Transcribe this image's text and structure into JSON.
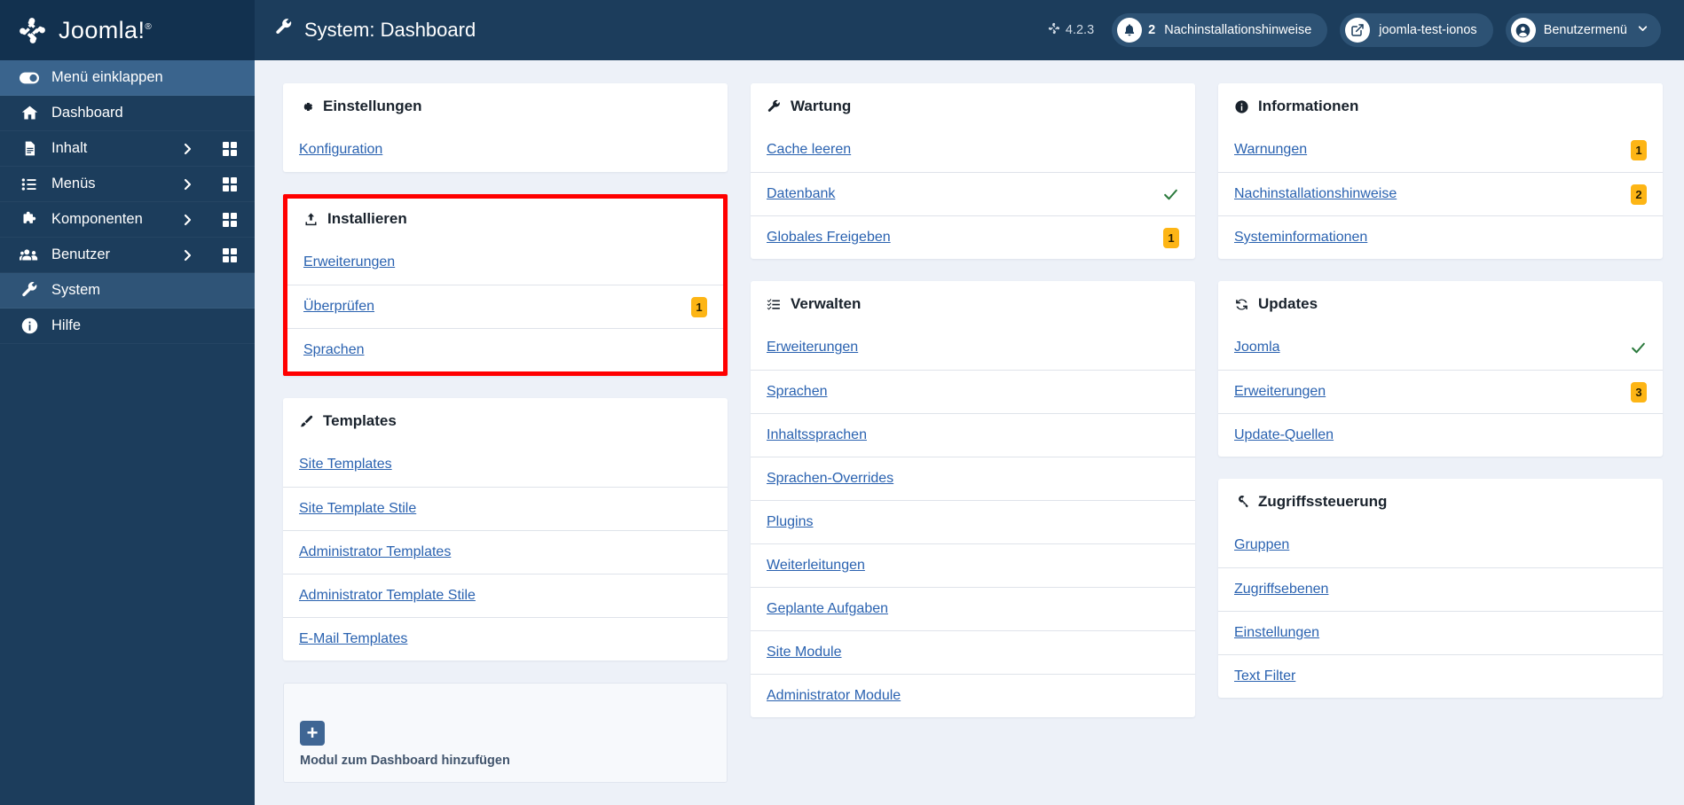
{
  "brand": {
    "name": "Joomla!",
    "trademark": "®"
  },
  "sidebar": {
    "collapse_label": "Menü einklappen",
    "items": [
      {
        "label": "Dashboard",
        "icon": "home-icon",
        "arrow": false,
        "grid": false,
        "active": false
      },
      {
        "label": "Inhalt",
        "icon": "document-icon",
        "arrow": true,
        "grid": true,
        "active": false
      },
      {
        "label": "Menüs",
        "icon": "list-icon",
        "arrow": true,
        "grid": true,
        "active": false
      },
      {
        "label": "Komponenten",
        "icon": "puzzle-icon",
        "arrow": true,
        "grid": true,
        "active": false
      },
      {
        "label": "Benutzer",
        "icon": "users-icon",
        "arrow": true,
        "grid": true,
        "active": false
      },
      {
        "label": "System",
        "icon": "wrench-icon",
        "arrow": false,
        "grid": false,
        "active": true
      },
      {
        "label": "Hilfe",
        "icon": "info-icon",
        "arrow": false,
        "grid": false,
        "active": false
      }
    ]
  },
  "header": {
    "title": "System: Dashboard",
    "version": "4.2.3",
    "notifications": {
      "count": "2",
      "label": "Nachinstallationshinweise"
    },
    "site": {
      "label": "joomla-test-ionos"
    },
    "user": {
      "label": "Benutzermenü"
    }
  },
  "panels": {
    "einstellungen": {
      "title": "Einstellungen",
      "icon": "gear-icon",
      "rows": [
        {
          "label": "Konfiguration",
          "badge": "",
          "check": false
        }
      ]
    },
    "installieren": {
      "title": "Installieren",
      "icon": "upload-icon",
      "highlighted": true,
      "rows": [
        {
          "label": "Erweiterungen",
          "badge": "",
          "check": false
        },
        {
          "label": "Überprüfen",
          "badge": "1",
          "check": false
        },
        {
          "label": "Sprachen",
          "badge": "",
          "check": false
        }
      ]
    },
    "templates": {
      "title": "Templates",
      "icon": "brush-icon",
      "rows": [
        {
          "label": "Site Templates",
          "badge": "",
          "check": false
        },
        {
          "label": "Site Template Stile",
          "badge": "",
          "check": false
        },
        {
          "label": "Administrator Templates",
          "badge": "",
          "check": false
        },
        {
          "label": "Administrator Template Stile",
          "badge": "",
          "check": false
        },
        {
          "label": "E-Mail Templates",
          "badge": "",
          "check": false
        }
      ]
    },
    "add_module": {
      "label": "Modul zum Dashboard hinzufügen",
      "icon": "plus-icon"
    },
    "wartung": {
      "title": "Wartung",
      "icon": "wrench-icon",
      "rows": [
        {
          "label": "Cache leeren",
          "badge": "",
          "check": false
        },
        {
          "label": "Datenbank",
          "badge": "",
          "check": true
        },
        {
          "label": "Globales Freigeben",
          "badge": "1",
          "check": false
        }
      ]
    },
    "verwalten": {
      "title": "Verwalten",
      "icon": "tasklist-icon",
      "rows": [
        {
          "label": "Erweiterungen",
          "badge": "",
          "check": false
        },
        {
          "label": "Sprachen",
          "badge": "",
          "check": false
        },
        {
          "label": "Inhaltssprachen",
          "badge": "",
          "check": false
        },
        {
          "label": "Sprachen-Overrides",
          "badge": "",
          "check": false
        },
        {
          "label": "Plugins",
          "badge": "",
          "check": false
        },
        {
          "label": "Weiterleitungen",
          "badge": "",
          "check": false
        },
        {
          "label": "Geplante Aufgaben",
          "badge": "",
          "check": false
        },
        {
          "label": "Site Module",
          "badge": "",
          "check": false
        },
        {
          "label": "Administrator Module",
          "badge": "",
          "check": false
        }
      ]
    },
    "informationen": {
      "title": "Informationen",
      "icon": "info-icon",
      "rows": [
        {
          "label": "Warnungen",
          "badge": "1",
          "check": false
        },
        {
          "label": "Nachinstallationshinweise",
          "badge": "2",
          "check": false
        },
        {
          "label": "Systeminformationen",
          "badge": "",
          "check": false
        }
      ]
    },
    "updates": {
      "title": "Updates",
      "icon": "refresh-icon",
      "rows": [
        {
          "label": "Joomla",
          "badge": "",
          "check": true
        },
        {
          "label": "Erweiterungen",
          "badge": "3",
          "check": false
        },
        {
          "label": "Update-Quellen",
          "badge": "",
          "check": false
        }
      ]
    },
    "zugriffssteuerung": {
      "title": "Zugriffssteuerung",
      "icon": "key-icon",
      "rows": [
        {
          "label": "Gruppen",
          "badge": "",
          "check": false
        },
        {
          "label": "Zugriffsebenen",
          "badge": "",
          "check": false
        },
        {
          "label": "Einstellungen",
          "badge": "",
          "check": false
        },
        {
          "label": "Text Filter",
          "badge": "",
          "check": false
        }
      ]
    }
  },
  "colors": {
    "sidebar_bg": "#1c3d5c",
    "sidebar_brand_bg": "#12314f",
    "content_bg": "#edf1f8",
    "link": "#2a62b0",
    "badge": "#fdb515",
    "check": "#2b7a3d",
    "highlight": "#ff0000"
  }
}
